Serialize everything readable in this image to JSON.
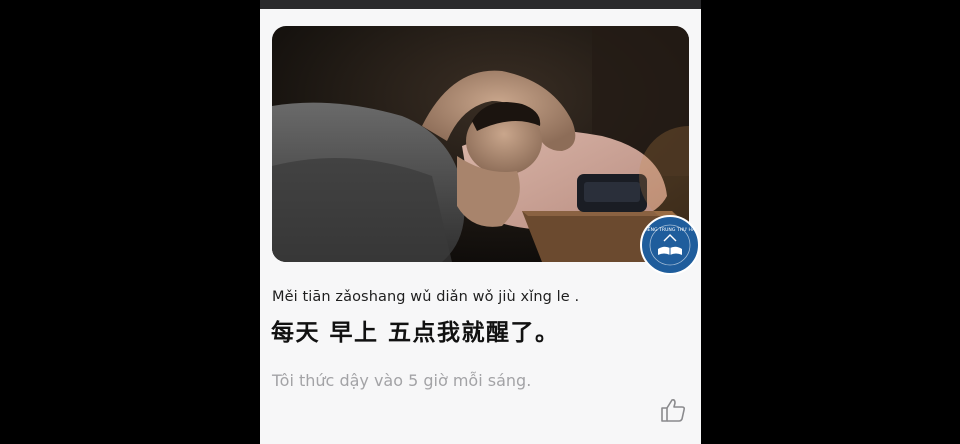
{
  "lesson": {
    "pinyin": "Měi tiān zǎoshang wǔ diǎn wǒ jiù xǐng le .",
    "hanzi": "每天 早上 五点我就醒了。",
    "translation": "Tôi thức dậy vào 5 giờ mỗi sáng.",
    "badge_text": "TIẾNG TRUNG THƯ HẢI"
  },
  "icons": {
    "like": "thumbs-up-icon",
    "badge": "book-logo-icon"
  }
}
